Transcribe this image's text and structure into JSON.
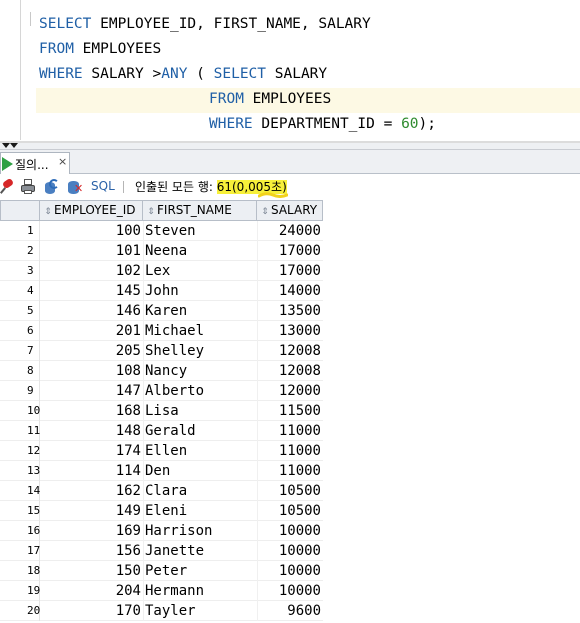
{
  "editor": {
    "line1": {
      "kw1": "SELECT",
      "rest": " EMPLOYEE_ID, FIRST_NAME, SALARY"
    },
    "line2": {
      "kw1": "FROM",
      "rest": " EMPLOYEES"
    },
    "line3": {
      "kw1": "WHERE",
      "mid": " SALARY >",
      "kw2": "ANY",
      "mid2": " ( ",
      "kw3": "SELECT",
      "rest": " SALARY"
    },
    "line4": {
      "kw1": "FROM",
      "rest": " EMPLOYEES"
    },
    "line5": {
      "kw1": "WHERE",
      "mid": " DEPARTMENT_ID = ",
      "num": "60",
      "rest": ");"
    }
  },
  "results_tab": {
    "label": "질의...",
    "close": "×"
  },
  "toolbar": {
    "sql_label": "SQL",
    "fetched_prefix": "인출된 모든 행: ",
    "fetched_value": "61(0,005초)"
  },
  "colors": {
    "keyword": "#1f5fa6",
    "number": "#2e8b2e",
    "run": "#2ea043",
    "highlight": "#f7f03a"
  },
  "grid": {
    "columns": [
      "EMPLOYEE_ID",
      "FIRST_NAME",
      "SALARY"
    ],
    "rows": [
      {
        "n": "1",
        "id": "100",
        "name": "Steven",
        "salary": "24000"
      },
      {
        "n": "2",
        "id": "101",
        "name": "Neena",
        "salary": "17000"
      },
      {
        "n": "3",
        "id": "102",
        "name": "Lex",
        "salary": "17000"
      },
      {
        "n": "4",
        "id": "145",
        "name": "John",
        "salary": "14000"
      },
      {
        "n": "5",
        "id": "146",
        "name": "Karen",
        "salary": "13500"
      },
      {
        "n": "6",
        "id": "201",
        "name": "Michael",
        "salary": "13000"
      },
      {
        "n": "7",
        "id": "205",
        "name": "Shelley",
        "salary": "12008"
      },
      {
        "n": "8",
        "id": "108",
        "name": "Nancy",
        "salary": "12008"
      },
      {
        "n": "9",
        "id": "147",
        "name": "Alberto",
        "salary": "12000"
      },
      {
        "n": "10",
        "id": "168",
        "name": "Lisa",
        "salary": "11500"
      },
      {
        "n": "11",
        "id": "148",
        "name": "Gerald",
        "salary": "11000"
      },
      {
        "n": "12",
        "id": "174",
        "name": "Ellen",
        "salary": "11000"
      },
      {
        "n": "13",
        "id": "114",
        "name": "Den",
        "salary": "11000"
      },
      {
        "n": "14",
        "id": "162",
        "name": "Clara",
        "salary": "10500"
      },
      {
        "n": "15",
        "id": "149",
        "name": "Eleni",
        "salary": "10500"
      },
      {
        "n": "16",
        "id": "169",
        "name": "Harrison",
        "salary": "10000"
      },
      {
        "n": "17",
        "id": "156",
        "name": "Janette",
        "salary": "10000"
      },
      {
        "n": "18",
        "id": "150",
        "name": "Peter",
        "salary": "10000"
      },
      {
        "n": "19",
        "id": "204",
        "name": "Hermann",
        "salary": "10000"
      },
      {
        "n": "20",
        "id": "170",
        "name": "Tayler",
        "salary": "9600"
      }
    ]
  }
}
